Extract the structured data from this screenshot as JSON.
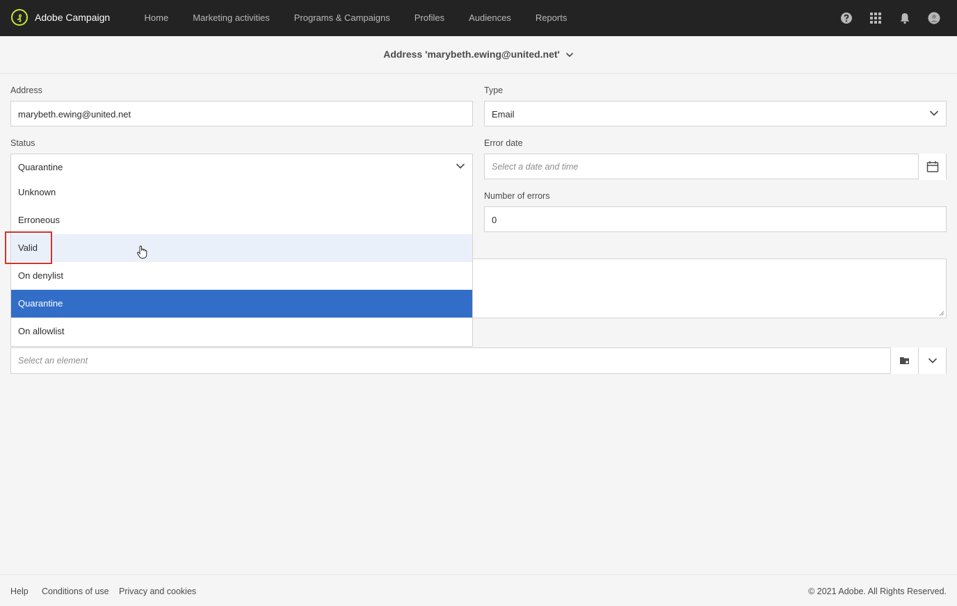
{
  "app": {
    "title": "Adobe Campaign",
    "logo_glyph": "₰",
    "accent": "#c6e83a"
  },
  "nav": [
    {
      "label": "Home"
    },
    {
      "label": "Marketing activities"
    },
    {
      "label": "Programs & Campaigns"
    },
    {
      "label": "Profiles"
    },
    {
      "label": "Audiences"
    },
    {
      "label": "Reports"
    }
  ],
  "header_icons": [
    "help-icon",
    "apps-grid-icon",
    "notifications-bell-icon",
    "user-avatar-icon"
  ],
  "page": {
    "title": "Address 'marybeth.ewing@united.net'"
  },
  "form": {
    "address": {
      "label": "Address",
      "value": "marybeth.ewing@united.net"
    },
    "type": {
      "label": "Type",
      "value": "Email"
    },
    "status": {
      "label": "Status",
      "value": "Quarantine"
    },
    "error_date": {
      "label": "Error date",
      "placeholder": "Select a date and time"
    },
    "number_of_errors": {
      "label": "Number of errors",
      "value": "0"
    },
    "element": {
      "placeholder": "Select an element"
    }
  },
  "status_dropdown": {
    "options": [
      "Unknown",
      "Erroneous",
      "Valid",
      "On denylist",
      "Quarantine",
      "On allowlist"
    ],
    "hovered": "Valid",
    "selected": "Quarantine",
    "selected_color": "#326ec8",
    "highlight_color": "#d2342b"
  },
  "footer": {
    "links": [
      "Help",
      "Conditions of use",
      "Privacy and cookies"
    ],
    "copyright": "© 2021 Adobe. All Rights Reserved."
  }
}
